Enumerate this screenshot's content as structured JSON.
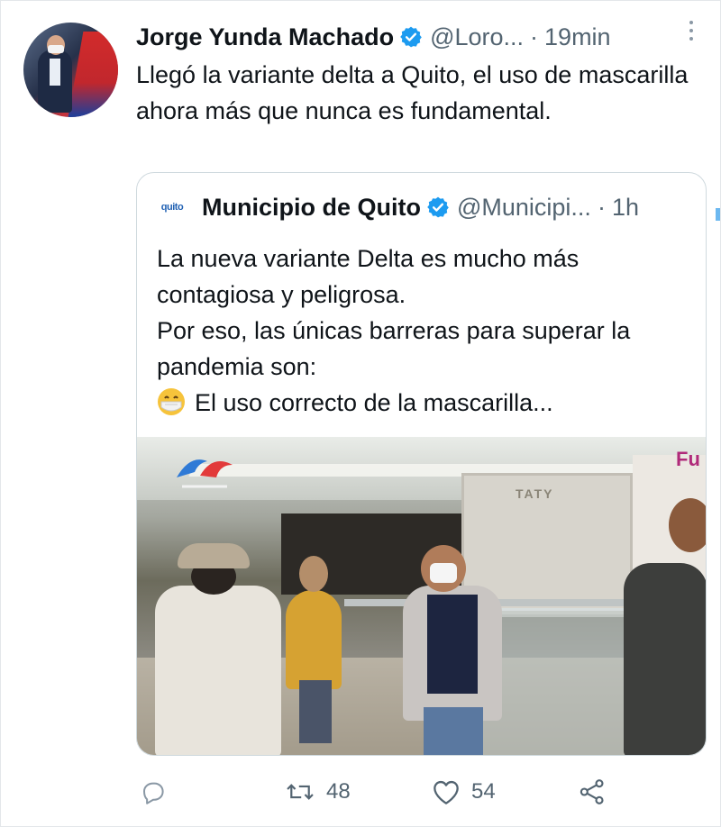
{
  "tweet": {
    "author_name": "Jorge Yunda Machado",
    "handle": "@Loro...",
    "separator": "·",
    "time": "19min",
    "text": "Llegó la variante delta a Quito, el uso de mascarilla ahora más que nunca es fundamental."
  },
  "quoted_tweet": {
    "logo_text": "quito",
    "author_name": "Municipio de Quito",
    "handle": "@Municipi...",
    "separator": "·",
    "time": "1h",
    "lines": [
      "La nueva variante Delta es mucho más contagiosa y peligrosa.",
      "Por eso, las únicas barreras para superar la pandemia son:",
      "El uso correcto de la mascarilla..."
    ],
    "media": {
      "store_label_1": "TATY",
      "store_label_2": "Fu"
    }
  },
  "actions": {
    "reply_icon": "reply-icon",
    "retweet_count": "48",
    "like_count": "54",
    "share_icon": "share-icon"
  },
  "colors": {
    "verified": "#1d9bf0",
    "secondary_text": "#536471",
    "border": "#cfd9de"
  }
}
